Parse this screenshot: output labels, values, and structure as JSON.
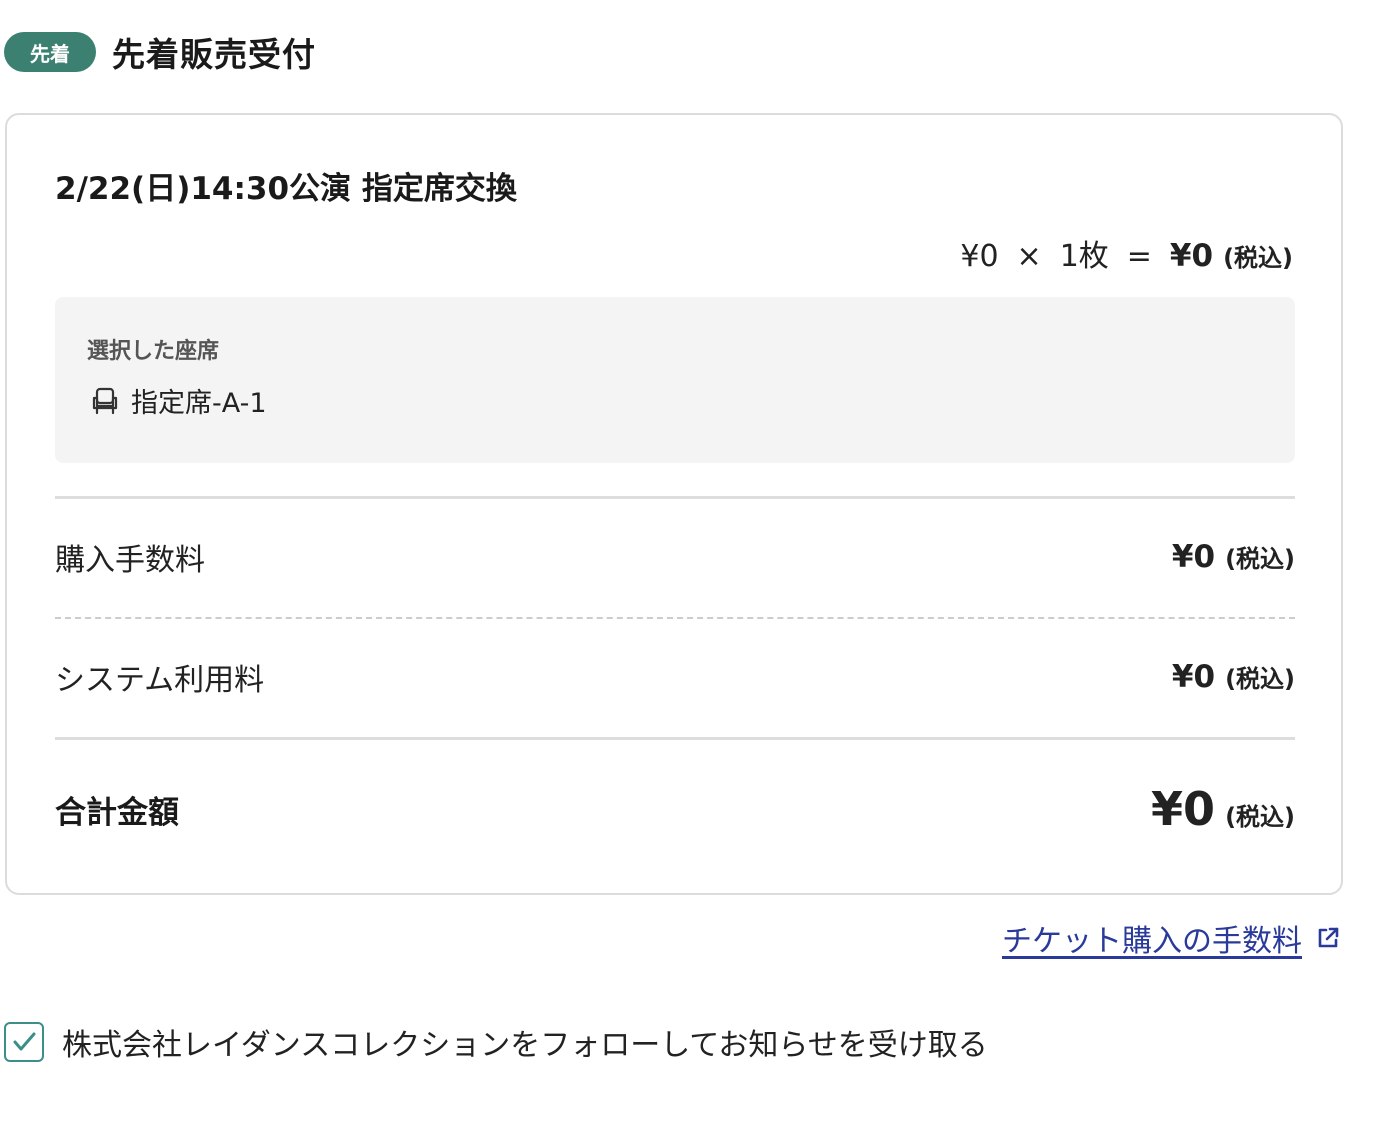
{
  "header": {
    "badge": "先着",
    "title": "先着販売受付"
  },
  "card": {
    "performance_title": "2/22(日)14:30公演 指定席交換",
    "price_line": {
      "unit_price": "¥0",
      "times": "×",
      "quantity": "1枚",
      "equals": "=",
      "subtotal": "¥0",
      "tax_note": "(税込)"
    },
    "seat_box": {
      "label": "選択した座席",
      "seat": "指定席-A-1"
    },
    "fees": [
      {
        "label": "購入手数料",
        "amount": "¥0",
        "tax_note": "(税込)"
      },
      {
        "label": "システム利用料",
        "amount": "¥0",
        "tax_note": "(税込)"
      }
    ],
    "total": {
      "label": "合計金額",
      "amount": "¥0",
      "tax_note": "(税込)"
    }
  },
  "fee_link": {
    "label": "チケット購入の手数料"
  },
  "follow": {
    "checked": true,
    "label": "株式会社レイダンスコレクションをフォローしてお知らせを受け取る"
  },
  "colors": {
    "badge_bg": "#3b8070",
    "link": "#2a3a9a",
    "checkbox": "#3b8f86",
    "seat_box_bg": "#f4f4f4"
  },
  "icons": {
    "seat": "seat-icon",
    "external_link": "external-link-icon",
    "checkmark": "checkmark-icon"
  }
}
